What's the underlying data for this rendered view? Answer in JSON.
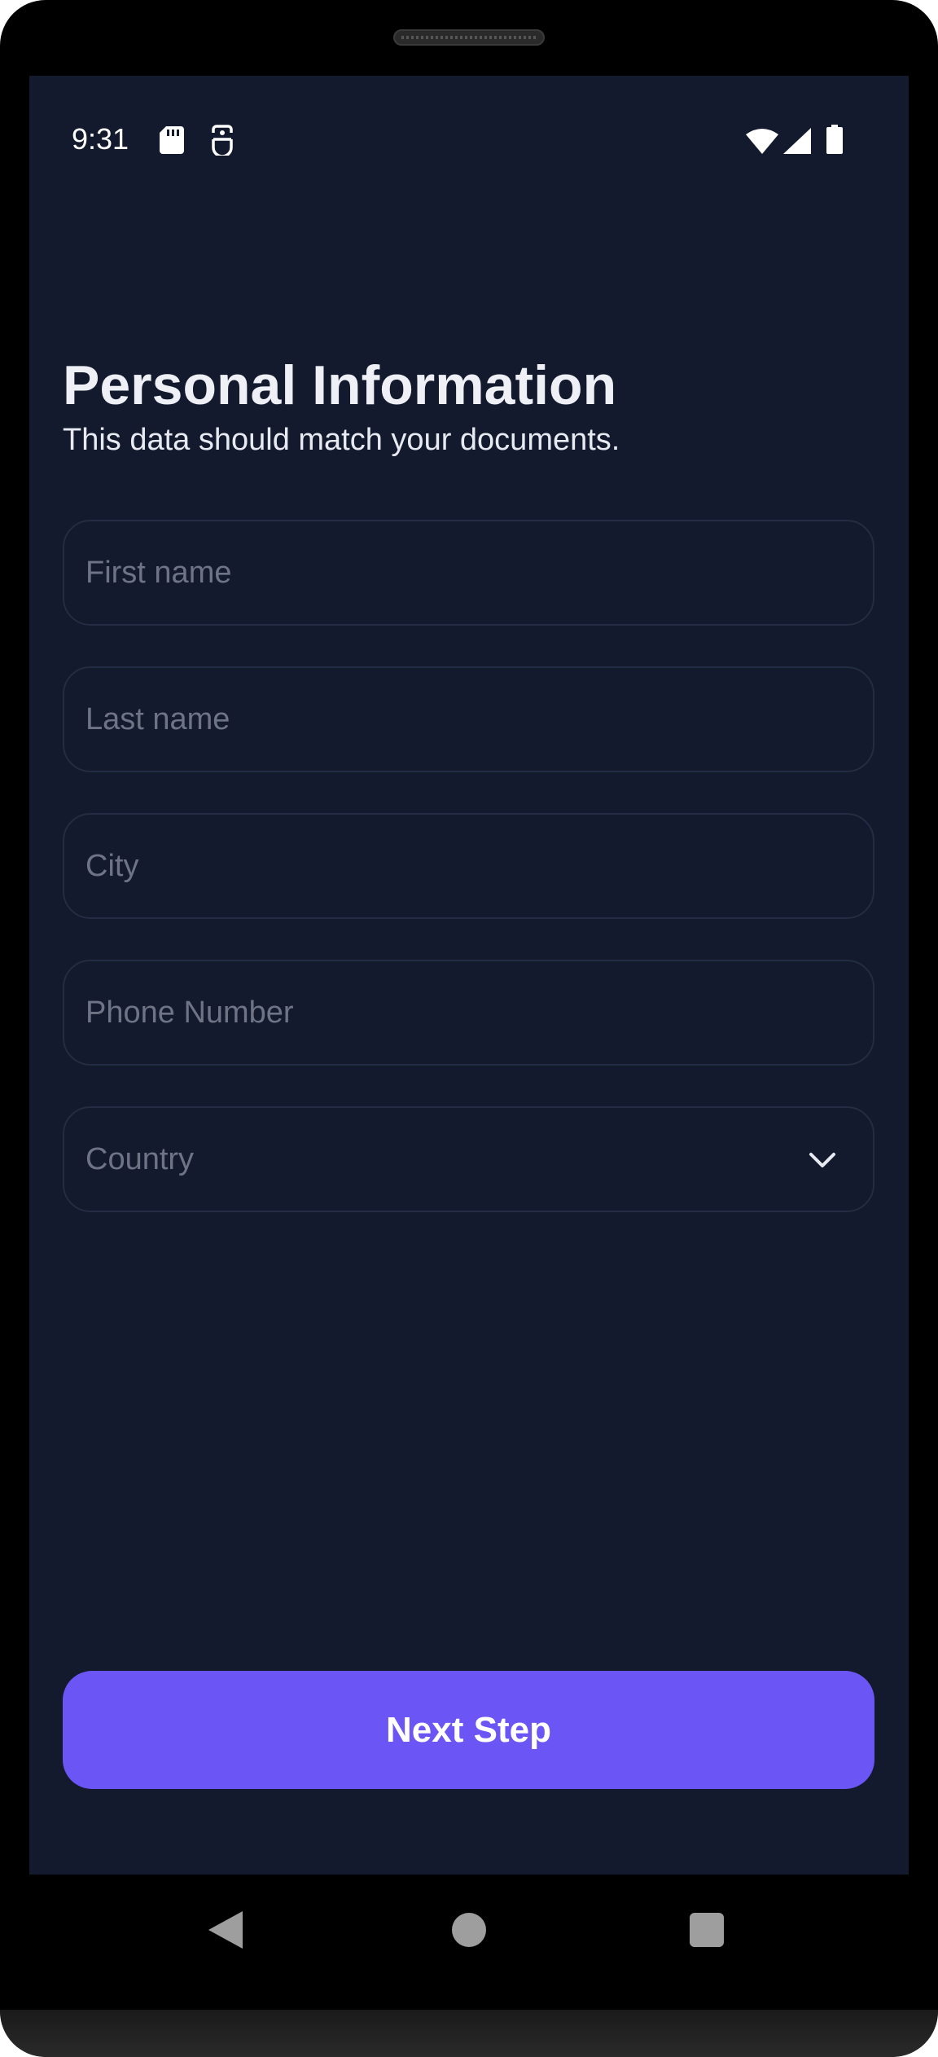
{
  "status_bar": {
    "time": "9:31",
    "icons": [
      "sd-card-icon",
      "sim-icon",
      "wifi-icon",
      "signal-icon",
      "battery-icon"
    ]
  },
  "header": {
    "title": "Personal Information",
    "subtitle": "This data should match your documents."
  },
  "form": {
    "first_name": {
      "placeholder": "First name",
      "value": ""
    },
    "last_name": {
      "placeholder": "Last name",
      "value": ""
    },
    "city": {
      "placeholder": "City",
      "value": ""
    },
    "phone": {
      "placeholder": "Phone Number",
      "value": ""
    },
    "country": {
      "placeholder": "Country",
      "icon": "chevron-down-icon"
    }
  },
  "actions": {
    "next_label": "Next Step"
  },
  "navigation": {
    "icons": [
      "back-icon",
      "home-icon",
      "recents-icon"
    ]
  },
  "colors": {
    "background": "#131a2d",
    "field_border": "#232c42",
    "placeholder": "#6e7486",
    "primary": "#6b55f5",
    "text": "#eef0f6"
  }
}
